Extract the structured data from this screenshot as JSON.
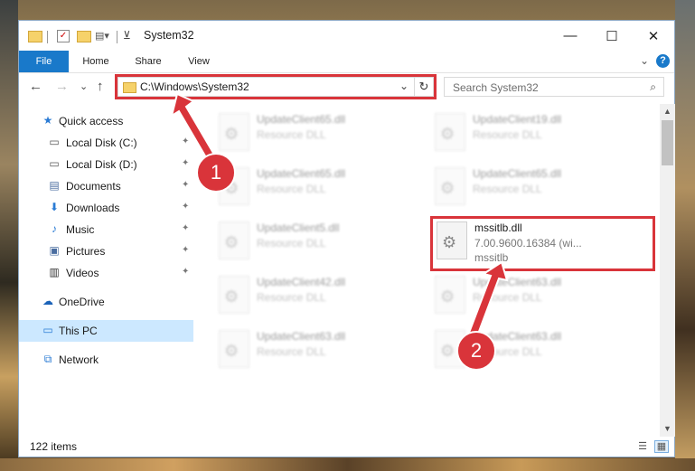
{
  "window": {
    "title": "System32",
    "qa_check_glyph": "✓",
    "buttons": {
      "minimize": "—",
      "maximize": "☐",
      "close": "✕"
    }
  },
  "ribbon": {
    "tabs": [
      "File",
      "Home",
      "Share",
      "View"
    ],
    "collapse_glyph": "⌄",
    "help": "?"
  },
  "nav": {
    "back": "←",
    "forward": "→",
    "recent": "⌄",
    "up": "↑",
    "address": "C:\\Windows\\System32",
    "address_chevron": "⌄",
    "refresh": "↻",
    "search_placeholder": "Search System32",
    "search_glyph": "⌕"
  },
  "sidebar": {
    "pin_glyph": "✦",
    "items": [
      {
        "label": "Quick access",
        "icon": "star-icon",
        "glyph": "★"
      },
      {
        "label": "Local Disk (C:)",
        "icon": "drive-icon",
        "glyph": "▭"
      },
      {
        "label": "Local Disk (D:)",
        "icon": "drive-icon",
        "glyph": "▭"
      },
      {
        "label": "Documents",
        "icon": "documents-icon",
        "glyph": "▤"
      },
      {
        "label": "Downloads",
        "icon": "download-icon",
        "glyph": "⬇"
      },
      {
        "label": "Music",
        "icon": "music-icon",
        "glyph": "♪"
      },
      {
        "label": "Pictures",
        "icon": "pictures-icon",
        "glyph": "▣"
      },
      {
        "label": "Videos",
        "icon": "videos-icon",
        "glyph": "▥"
      },
      {
        "label": "OneDrive",
        "icon": "cloud-icon",
        "glyph": "☁"
      },
      {
        "label": "This PC",
        "icon": "computer-icon",
        "glyph": "▭"
      },
      {
        "label": "Network",
        "icon": "network-icon",
        "glyph": "⧉"
      }
    ]
  },
  "files": [
    {
      "name": "UpdateClient65.dll",
      "sub": "Resource DLL"
    },
    {
      "name": "UpdateClient19.dll",
      "sub": "Resource DLL"
    },
    {
      "name": "UpdateClient65.dll",
      "sub": "Resource DLL"
    },
    {
      "name": "UpdateClient65.dll",
      "sub": "Resource DLL"
    },
    {
      "name": "UpdateClient5.dll",
      "sub": "Resource DLL"
    },
    {
      "name": "mssitlb.dll",
      "sub": "7.00.9600.16384 (wi...",
      "sub2": "mssitlb"
    },
    {
      "name": "UpdateClient42.dll",
      "sub": "Resource DLL"
    },
    {
      "name": "UpdateClient63.dll",
      "sub": "Resource DLL"
    },
    {
      "name": "UpdateClient63.dll",
      "sub": "Resource DLL"
    },
    {
      "name": "UpdateClient63.dll",
      "sub": "Resource DLL"
    }
  ],
  "file_icon_glyph": "⚙",
  "scrollbar": {
    "up": "▲",
    "down": "▼"
  },
  "status": {
    "item_count": "122 items",
    "details_glyph": "☰",
    "tiles_glyph": "▦"
  },
  "callouts": [
    "1",
    "2"
  ],
  "colors": {
    "accent": "#1979ca",
    "highlight": "#d9343a",
    "selected": "#cce8ff"
  }
}
